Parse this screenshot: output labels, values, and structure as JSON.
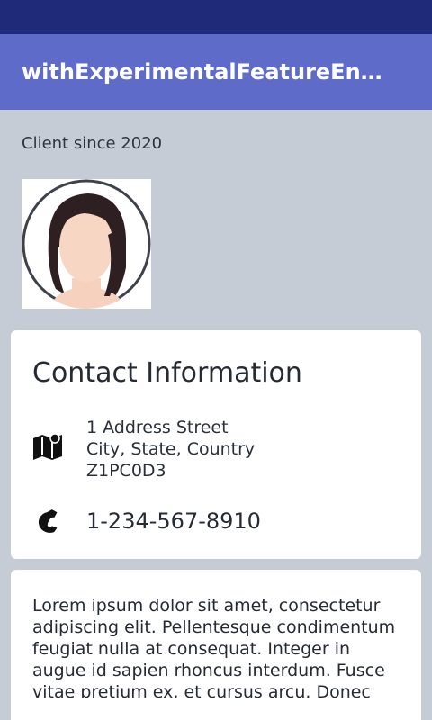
{
  "app_bar": {
    "title": "withExperimentalFeatureEna…"
  },
  "profile": {
    "client_since": "Client since 2020",
    "avatar_icon": "female-avatar-icon"
  },
  "contact": {
    "title": "Contact Information",
    "address_icon": "map-icon",
    "address_line1": "1 Address Street",
    "address_line2": "City, State, Country",
    "address_line3": "Z1PC0D3",
    "phone_icon": "phone-icon",
    "phone": "1-234-567-8910"
  },
  "about": {
    "text": "Lorem ipsum dolor sit amet, consectetur adipiscing elit. Pellentesque condimentum feugiat nulla at consequat. Integer in augue id sapien rhoncus interdum. Fusce vitae pretium ex, et cursus arcu. Donec tempor"
  },
  "colors": {
    "status_bar": "#1f2a78",
    "app_bar": "#5f6bc9",
    "background": "#c5ccd5",
    "card": "#ffffff"
  }
}
